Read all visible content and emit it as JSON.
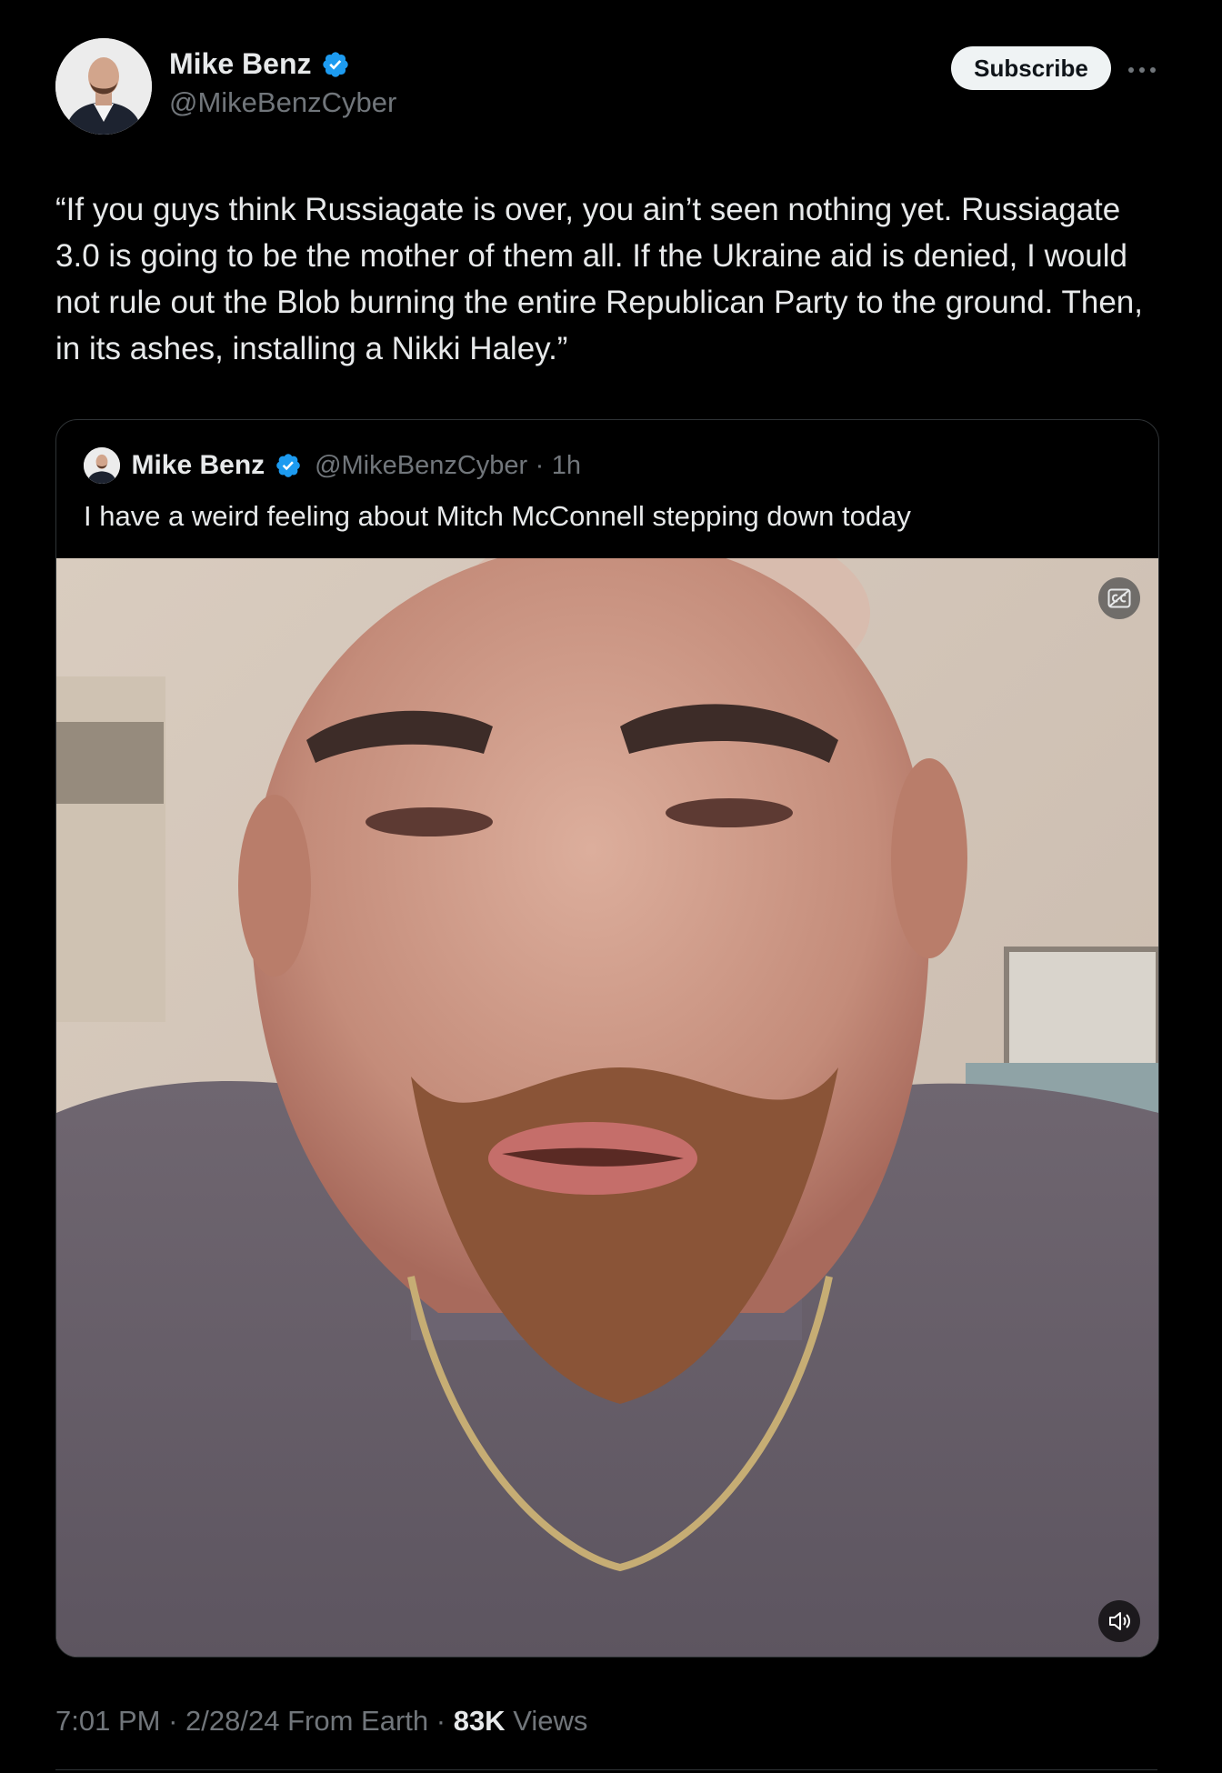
{
  "author": {
    "display_name": "Mike Benz",
    "handle": "@MikeBenzCyber",
    "verified": true
  },
  "actions": {
    "subscribe_label": "Subscribe",
    "more_icon": "ellipsis-icon"
  },
  "tweet": {
    "text": "“If you guys think Russiagate is over, you ain’t seen nothing yet. Russiagate 3.0 is going to be the mother of them all. If the Ukraine aid is denied, I would not rule out the Blob burning the entire Republican Party to the ground. Then, in its ashes, installing a Nikki Haley.”"
  },
  "quoted_tweet": {
    "display_name": "Mike Benz",
    "handle": "@MikeBenzCyber",
    "separator": "·",
    "time": "1h",
    "text": "I have a weird feeling about Mitch McConnell stepping down today",
    "media": {
      "type": "video",
      "captions_icon": "captions-icon",
      "volume_icon": "volume-icon"
    }
  },
  "meta": {
    "time": "7:01 PM",
    "separator": "·",
    "date": "2/28/24",
    "location": "From Earth",
    "views_count": "83K",
    "views_label": "Views"
  },
  "colors": {
    "background": "#000000",
    "text_primary": "#e7e9ea",
    "text_secondary": "#71767b",
    "verified_blue": "#1d9bf0",
    "border": "#2f3336"
  }
}
